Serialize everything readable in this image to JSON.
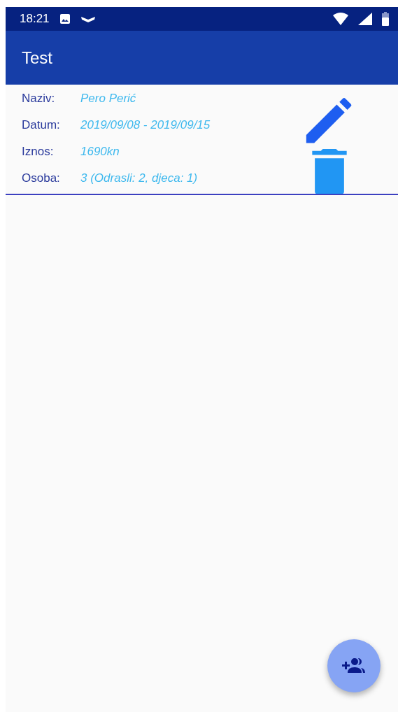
{
  "status_bar": {
    "time": "18:21"
  },
  "app_bar": {
    "title": "Test"
  },
  "entries": [
    {
      "fields": [
        {
          "label": "Naziv:",
          "value": "Pero Perić"
        },
        {
          "label": "Datum:",
          "value": "2019/09/08 - 2019/09/15"
        },
        {
          "label": "Iznos:",
          "value": "1690kn"
        },
        {
          "label": "Osoba:",
          "value": "3 (Odrasli: 2, djeca: 1)"
        }
      ]
    }
  ]
}
